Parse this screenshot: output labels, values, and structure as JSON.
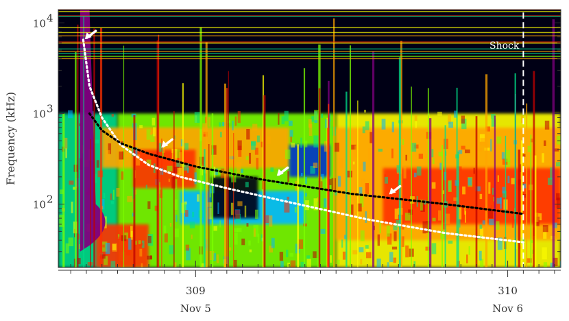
{
  "chart_data": {
    "type": "heatmap",
    "title": "",
    "xlabel": "",
    "ylabel": "Frequency (kHz)",
    "x_scale": "linear",
    "y_scale": "log",
    "xlim": [
      308.56,
      310.17
    ],
    "ylim": [
      20,
      14000
    ],
    "x_ticks": [
      {
        "value": 309,
        "label": "309",
        "sublabel": "Nov 5"
      },
      {
        "value": 310,
        "label": "310",
        "sublabel": "Nov 6"
      }
    ],
    "y_ticks": [
      {
        "value": 100,
        "base": "10",
        "exp": "2"
      },
      {
        "value": 1000,
        "base": "10",
        "exp": "3"
      },
      {
        "value": 10000,
        "base": "10",
        "exp": "4"
      }
    ],
    "series": [
      {
        "style": "white-dotted",
        "x": [
          308.64,
          308.66,
          308.7,
          308.76,
          308.85,
          308.95,
          309.1,
          309.3,
          309.55,
          309.8,
          310.05
        ],
        "y": [
          6500,
          2000,
          900,
          450,
          270,
          200,
          150,
          105,
          68,
          48,
          38
        ]
      },
      {
        "style": "black-dotted",
        "x": [
          308.66,
          308.7,
          308.76,
          308.85,
          309.0,
          309.2,
          309.5,
          309.8,
          310.05
        ],
        "y": [
          1000,
          650,
          470,
          360,
          260,
          190,
          130,
          100,
          78
        ]
      }
    ],
    "shock": {
      "x": 310.05,
      "label": "Shock"
    },
    "arrows": [
      {
        "x": 308.645,
        "y": 6600
      },
      {
        "x": 308.89,
        "y": 420
      },
      {
        "x": 309.26,
        "y": 205
      },
      {
        "x": 309.62,
        "y": 128
      }
    ],
    "colorscale": [
      "#000014",
      "#0033cc",
      "#00b7ff",
      "#00e08a",
      "#7cff00",
      "#ffff00",
      "#ffa500",
      "#ff3000",
      "#c00000",
      "#800080"
    ]
  }
}
